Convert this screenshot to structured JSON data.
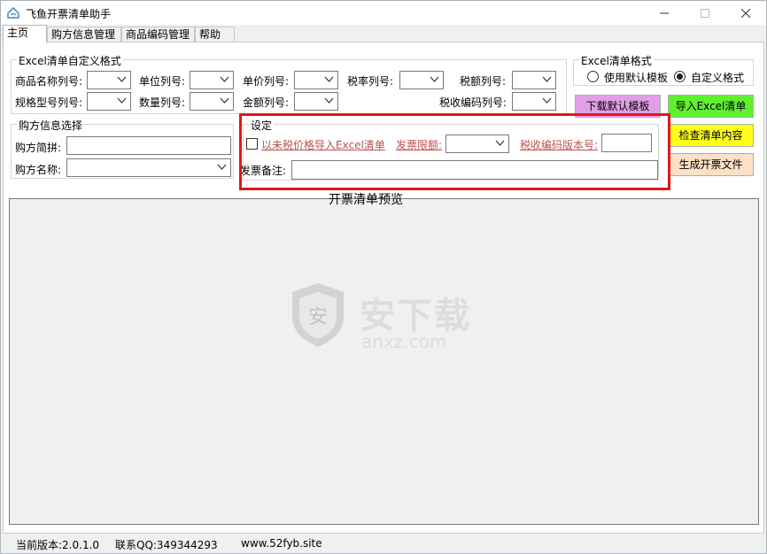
{
  "window": {
    "title": "飞鱼开票清单助手",
    "controls": {
      "minimize": "—",
      "maximize": "☐",
      "close": "✕"
    }
  },
  "tabs": [
    {
      "label": "主页"
    },
    {
      "label": "购方信息管理"
    },
    {
      "label": "商品编码管理"
    },
    {
      "label": "帮助"
    }
  ],
  "excel_custom": {
    "title": "Excel清单自定义格式",
    "fields": {
      "name_col": "商品名称列号:",
      "unit_col": "单位列号:",
      "price_col": "单价列号:",
      "taxrate_col": "税率列号:",
      "tax_col": "税额列号:",
      "spec_col": "规格型号列号:",
      "qty_col": "数量列号:",
      "amount_col": "金额列号:",
      "taxcode_col": "税收编码列号:"
    }
  },
  "excel_format": {
    "title": "Excel清单格式",
    "options": [
      {
        "label": "使用默认模板",
        "selected": false
      },
      {
        "label": "自定义格式",
        "selected": true
      }
    ]
  },
  "buyer": {
    "title": "购方信息选择",
    "abbr_label": "购方简拼:",
    "abbr_value": "",
    "name_label": "购方名称:",
    "name_value": ""
  },
  "settings": {
    "title": "设定",
    "untaxed_import": "以未税价格导入Excel清单",
    "invoice_limit": "发票限额:",
    "taxcode_version": "税收编码版本号:",
    "remark_label": "发票备注:",
    "remark_value": ""
  },
  "buttons": {
    "download_template": {
      "label": "下载默认模板",
      "color": "#e29ee6"
    },
    "import_excel": {
      "label": "导入Excel清单",
      "color": "#5ff02e"
    },
    "check_list": {
      "label": "检查清单内容",
      "color": "#ffff1a"
    },
    "generate_file": {
      "label": "生成开票文件",
      "color": "#fde0c6"
    }
  },
  "preview": {
    "title": "开票清单预览"
  },
  "watermark": {
    "text": "安下载",
    "url": "anxz.com"
  },
  "status": {
    "version": "当前版本:2.0.1.0",
    "qq": "联系QQ:349344293",
    "site": "www.52fyb.site"
  },
  "colors": {
    "highlight": "#e01818",
    "link": "#c0504d"
  }
}
